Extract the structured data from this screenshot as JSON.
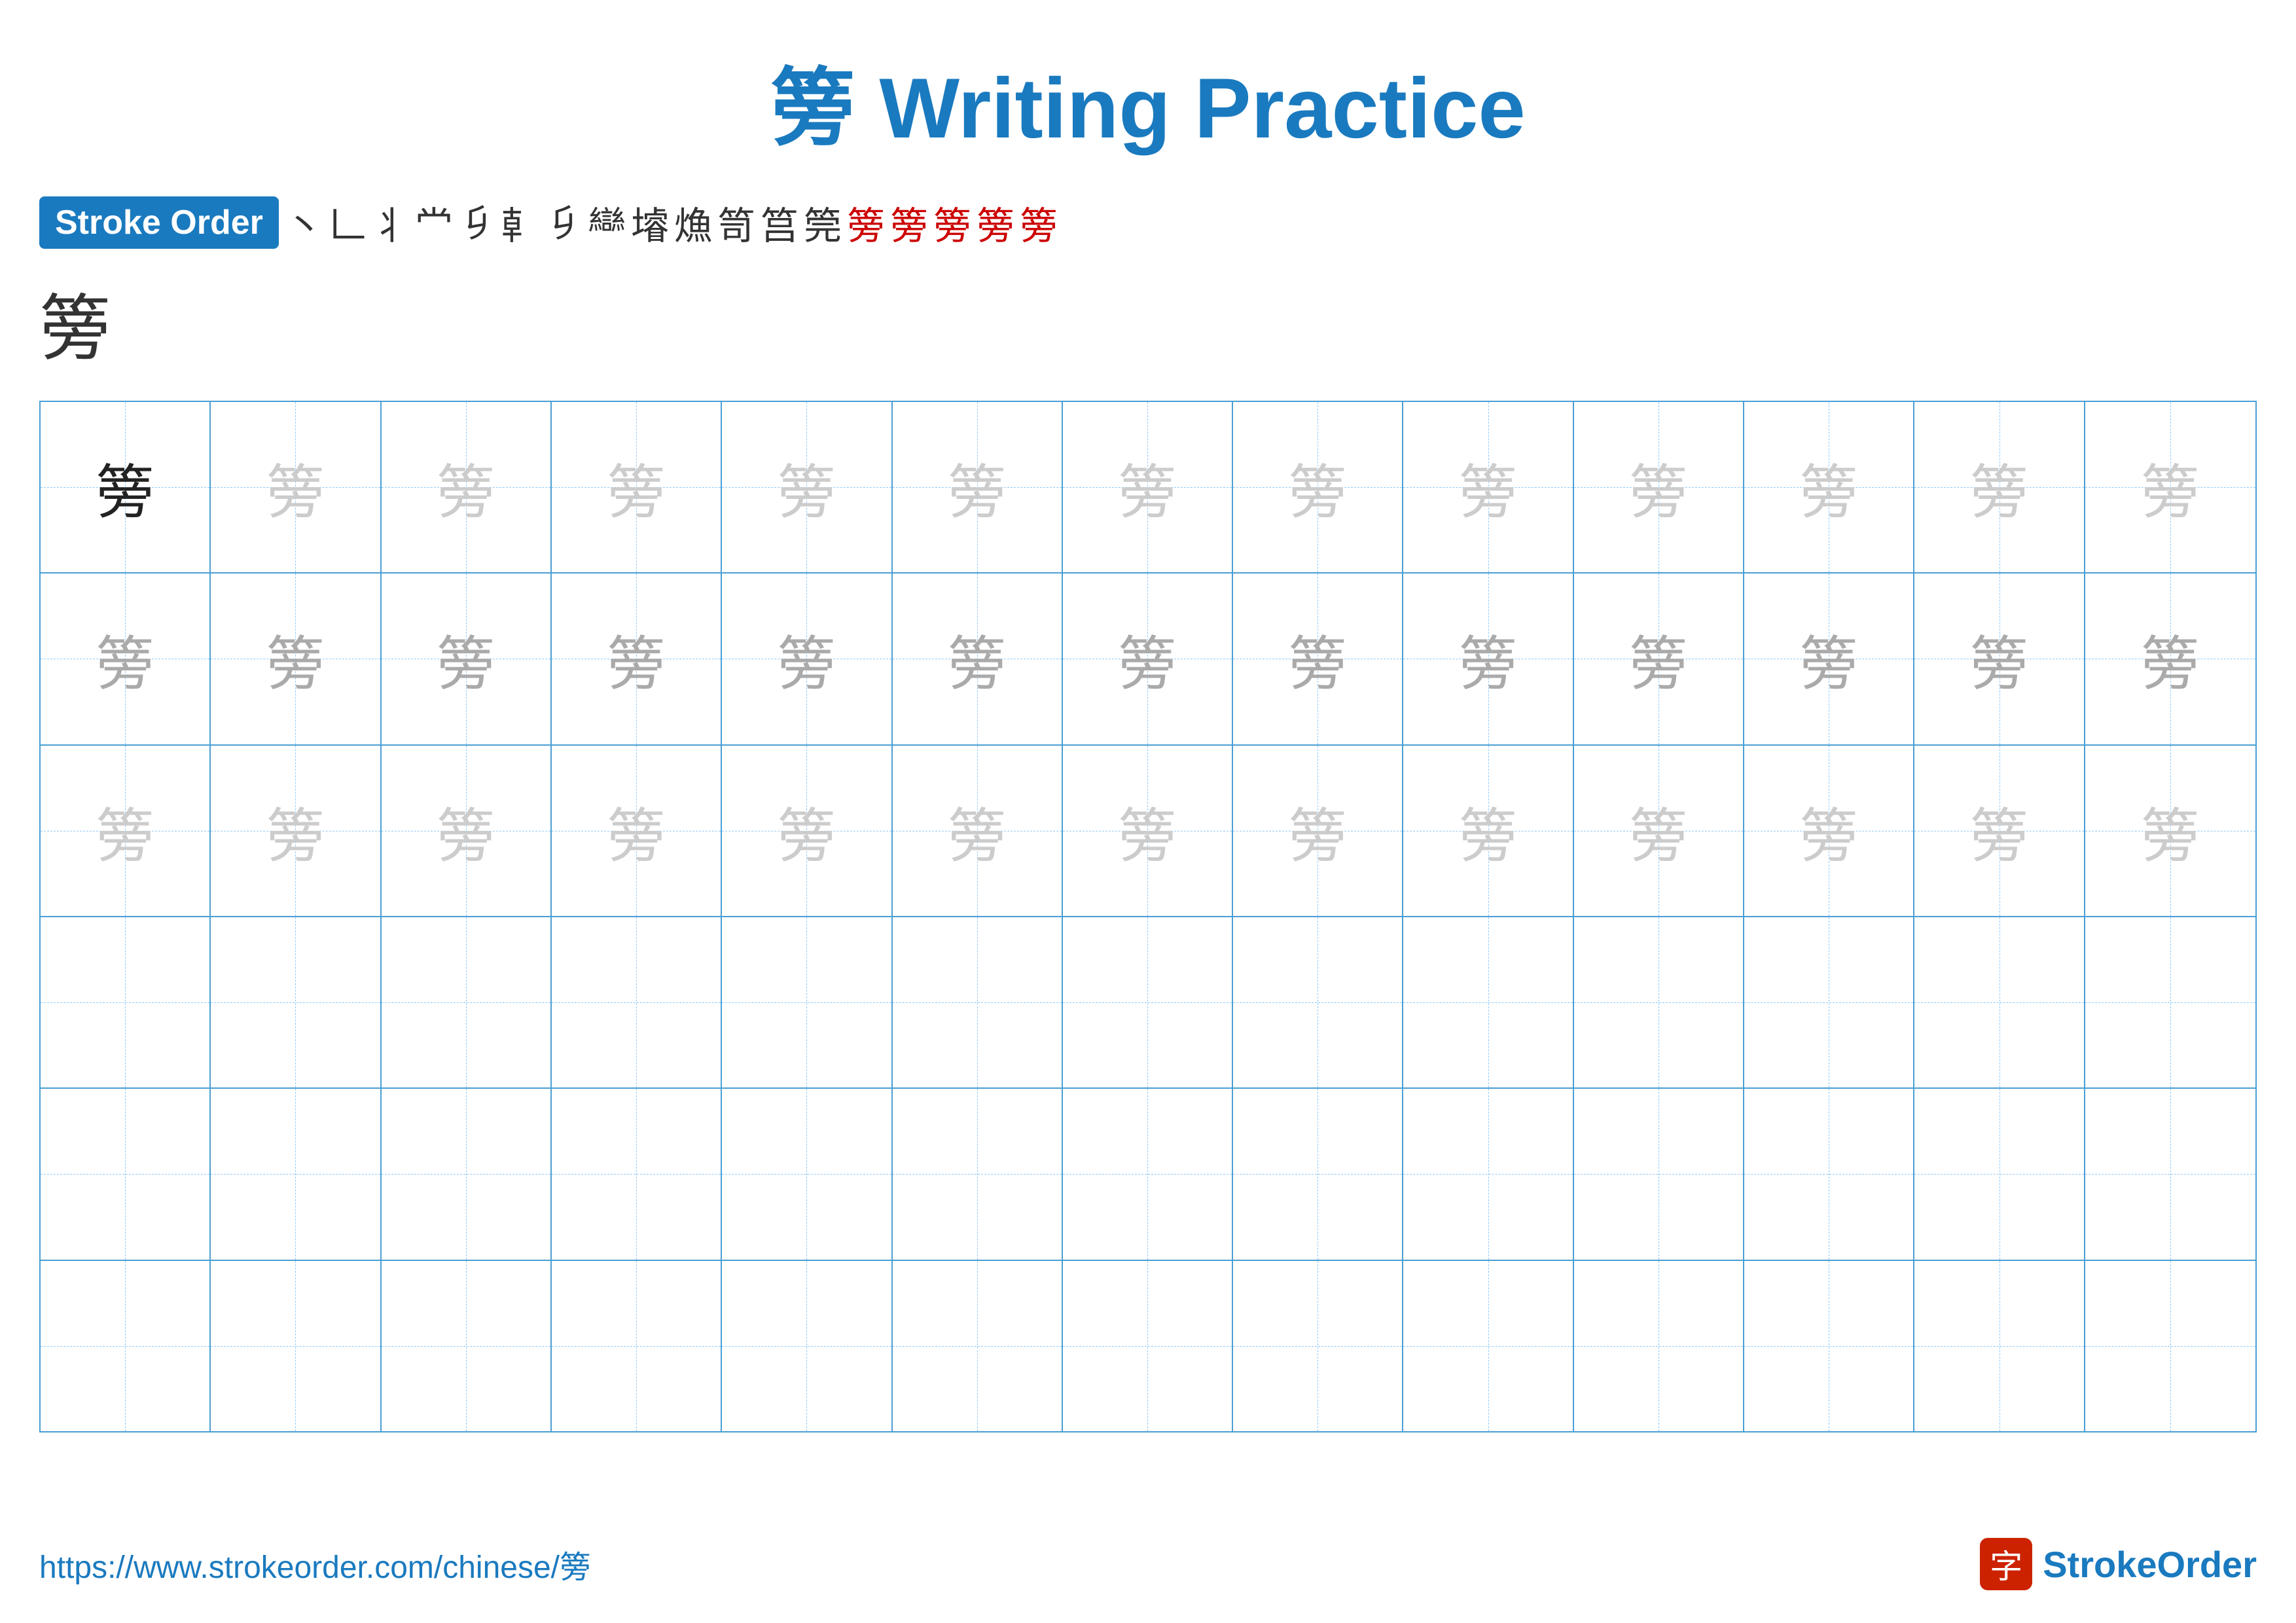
{
  "title": {
    "char": "篣",
    "text": " Writing Practice"
  },
  "strokeOrder": {
    "badge": "Stroke Order",
    "strokes": [
      "丶",
      "𠃊",
      "𠃑",
      "丬",
      "㐅",
      "㐅㐅",
      "𠂆㐅",
      "𠂆㐅㐅",
      "𠂆𠄌",
      "𠂆𠄌㐅",
      "筥",
      "筥㇛",
      "筦",
      "篣",
      "篣",
      "篣",
      "篣",
      "篣"
    ]
  },
  "practiceChar": "篣",
  "grid": {
    "rows": 6,
    "cols": 13,
    "char": "篣"
  },
  "footer": {
    "url": "https://www.strokeorder.com/chinese/篣",
    "logoChar": "字",
    "logoText": "StrokeOrder"
  }
}
